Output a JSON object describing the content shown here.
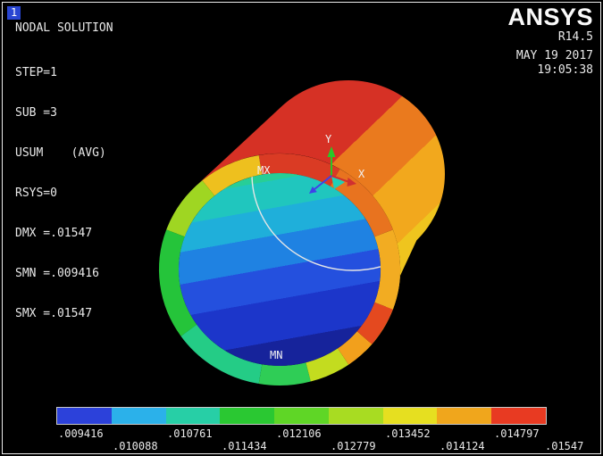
{
  "window": {
    "plot_number": "1"
  },
  "solution_info": {
    "title": "NODAL SOLUTION",
    "lines": [
      "STEP=1",
      "SUB =3",
      "USUM    (AVG)",
      "RSYS=0",
      "DMX =.01547",
      "SMN =.009416",
      "SMX =.01547"
    ]
  },
  "brand": {
    "name": "ANSYS",
    "release": "R14.5",
    "date": "MAY 19 2017",
    "time": "19:05:38"
  },
  "model": {
    "max_label": "MX",
    "min_label": "MN",
    "triad": {
      "x_label": "X",
      "y_label": "Y"
    }
  },
  "legend": {
    "values": [
      ".009416",
      ".010088",
      ".010761",
      ".011434",
      ".012106",
      ".012779",
      ".013452",
      ".014124",
      ".014797",
      ".01547"
    ],
    "colors": [
      "#2C41DA",
      "#2BB1EA",
      "#27CFA6",
      "#2AC832",
      "#5FD626",
      "#A8DC22",
      "#E6DF20",
      "#F0A61C",
      "#E83A22"
    ]
  }
}
